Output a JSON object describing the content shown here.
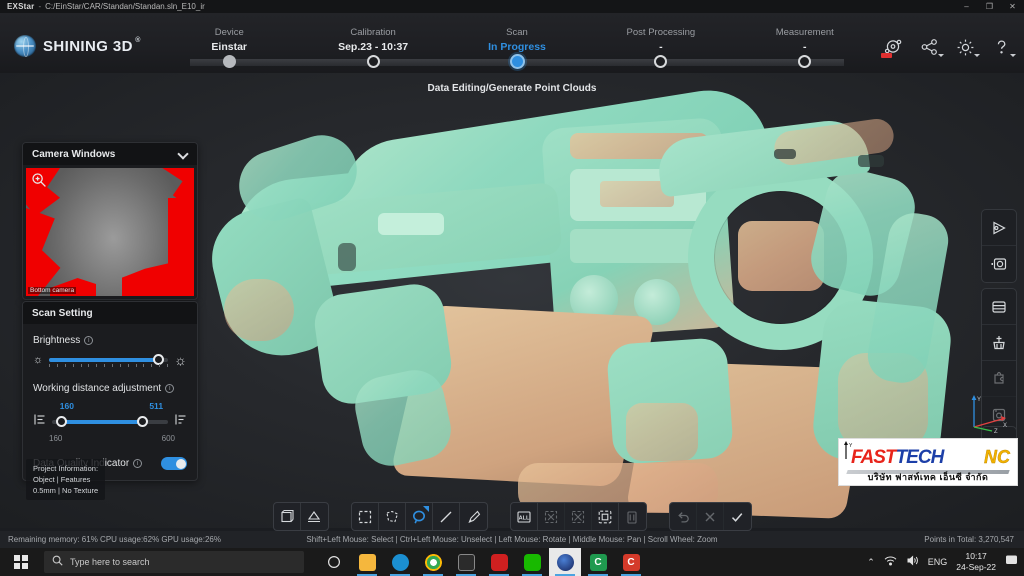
{
  "titlebar": {
    "app": "EXStar",
    "separator": "-",
    "path": "C:/EinStar/CAR/Standan/Standan.sln_E10_ir",
    "minimize": "–",
    "maximize": "❐",
    "close": "✕"
  },
  "brand": {
    "name": "SHINING 3D",
    "registered": "®",
    "icon": "globe-icon"
  },
  "steps": [
    {
      "label": "Device",
      "value": "Einstar",
      "state": "done"
    },
    {
      "label": "Calibration",
      "value": "Sep.23 - 10:37",
      "state": "done"
    },
    {
      "label": "Scan",
      "value": "In Progress",
      "state": "active"
    },
    {
      "label": "Post Processing",
      "value": "-",
      "state": "pending"
    },
    {
      "label": "Measurement",
      "value": "-",
      "state": "pending"
    }
  ],
  "substep": "Data Editing/Generate Point Clouds",
  "header_icons": [
    {
      "name": "scan-status-icon",
      "has_badge": true,
      "has_caret": false
    },
    {
      "name": "share-icon",
      "has_badge": false,
      "has_caret": true
    },
    {
      "name": "gear-icon",
      "has_badge": false,
      "has_caret": true
    },
    {
      "name": "help-icon",
      "has_badge": false,
      "has_caret": true
    }
  ],
  "camera_panel": {
    "title": "Camera Windows",
    "collapse_icon": "chevron-down-icon",
    "zoom_icon": "magnifier-plus-icon",
    "image_label": "Bottom camera"
  },
  "scan_setting": {
    "title": "Scan Setting",
    "brightness": {
      "label": "Brightness",
      "info_icon": "info-icon",
      "low_icon": "sun-small-icon",
      "high_icon": "sun-large-icon",
      "percent": 92
    },
    "working_distance": {
      "label": "Working distance adjustment",
      "info_icon": "info-icon",
      "min_value": "160",
      "max_value": "511",
      "range_min": "160",
      "range_max": "600",
      "left_icon": "distance-near-icon",
      "right_icon": "distance-far-icon",
      "left_percent": 8,
      "right_percent": 78
    },
    "data_quality": {
      "label": "Data Quality Indicator",
      "info_icon": "info-icon",
      "enabled": true
    }
  },
  "project_information": {
    "line1": "Project Information:",
    "line2": "Object | Features",
    "line3": "0.5mm | No Texture"
  },
  "right_rail": [
    [
      {
        "name": "play-scan-icon",
        "dim": false
      },
      {
        "name": "capture-frame-icon",
        "dim": false
      }
    ],
    [
      {
        "name": "layers-icon",
        "dim": false
      },
      {
        "name": "clean-brush-icon",
        "dim": false
      },
      {
        "name": "puzzle-align-icon",
        "dim": true
      },
      {
        "name": "save-project-icon",
        "dim": true
      }
    ],
    [
      {
        "name": "mesh-quality-icon",
        "dim": true
      }
    ]
  ],
  "toolbar_groups": [
    [
      {
        "name": "view-box-icon",
        "selected": false,
        "dim": false,
        "corner": false
      },
      {
        "name": "light-shade-icon",
        "selected": false,
        "dim": false,
        "corner": false
      }
    ],
    [
      {
        "name": "rect-select-icon",
        "selected": false,
        "dim": false,
        "corner": false
      },
      {
        "name": "polygon-select-icon",
        "selected": false,
        "dim": false,
        "corner": false
      },
      {
        "name": "lasso-select-icon",
        "selected": true,
        "dim": false,
        "corner": true
      },
      {
        "name": "line-select-icon",
        "selected": false,
        "dim": false,
        "corner": false
      },
      {
        "name": "brush-select-icon",
        "selected": false,
        "dim": false,
        "corner": false
      }
    ],
    [
      {
        "name": "select-all-icon",
        "selected": false,
        "dim": false,
        "corner": false,
        "text": "ALL"
      },
      {
        "name": "deselect-icon",
        "selected": false,
        "dim": true,
        "corner": false
      },
      {
        "name": "invert-select-icon",
        "selected": false,
        "dim": true,
        "corner": false
      },
      {
        "name": "crop-icon",
        "selected": false,
        "dim": false,
        "corner": false
      },
      {
        "name": "delete-icon",
        "selected": false,
        "dim": true,
        "corner": false
      }
    ],
    [
      {
        "name": "undo-icon",
        "selected": false,
        "dim": true,
        "corner": false
      },
      {
        "name": "cancel-icon",
        "selected": false,
        "dim": true,
        "corner": false
      },
      {
        "name": "confirm-icon",
        "selected": false,
        "dim": false,
        "corner": false
      }
    ]
  ],
  "logo": {
    "fast": "FAST",
    "tech": "TECH",
    "nc": "NC",
    "thai": "บริษัท  ฟาสท์เทค  เอ็นซี  จำกัด",
    "axis_y": "Y",
    "axis_x": "X"
  },
  "gizmo": {
    "x": "X",
    "y": "Y",
    "z": "Z"
  },
  "statusbar": {
    "resources": "Remaining memory: 61% CPU usage:62%  GPU usage:26%",
    "hints": "Shift+Left Mouse: Select | Ctrl+Left Mouse: Unselect | Left Mouse: Rotate | Middle Mouse: Pan | Scroll Wheel: Zoom",
    "points": "Points in Total: 3,270,547"
  },
  "taskbar": {
    "start_icon": "windows-start-icon",
    "search_icon": "search-icon",
    "search_placeholder": "Type here to search",
    "cortana_icon": "cortana-circle-icon",
    "apps": [
      {
        "name": "file-explorer-icon",
        "color": "#f5b73d",
        "glyph": "",
        "active": false,
        "running": true
      },
      {
        "name": "edge-browser-icon",
        "color": "#1b8fd1",
        "glyph": "",
        "active": false,
        "running": true
      },
      {
        "name": "chrome-browser-icon",
        "color": "#f1f1f1",
        "glyph": "",
        "active": false,
        "running": true
      },
      {
        "name": "microsoft-store-icon",
        "color": "#2b2b2b",
        "glyph": "",
        "active": false,
        "running": true
      },
      {
        "name": "red-app-icon",
        "color": "#d02020",
        "glyph": "",
        "active": false,
        "running": true
      },
      {
        "name": "line-messenger-icon",
        "color": "#18b900",
        "glyph": "",
        "active": false,
        "running": true
      },
      {
        "name": "exstar-app-icon",
        "color": "#1a2a5e",
        "glyph": "",
        "active": true,
        "running": true
      },
      {
        "name": "green-doc-icon",
        "color": "#1f9a4f",
        "glyph": "C",
        "active": false,
        "running": true
      },
      {
        "name": "red-doc-icon",
        "color": "#d43a2a",
        "glyph": "C",
        "active": false,
        "running": true
      }
    ],
    "tray": {
      "chevron": "⌃",
      "network_icon": "wifi-icon",
      "volume_icon": "speaker-icon",
      "language": "ENG",
      "time": "10:17",
      "date": "24-Sep-22",
      "notification_icon": "notification-icon"
    }
  },
  "colors": {
    "accent": "#2f8fe0",
    "mesh_mint": "#8fd9bf",
    "mesh_warm": "#dfae8a",
    "panel_bg": "#1b1c1f",
    "badge_red": "#e03030"
  }
}
